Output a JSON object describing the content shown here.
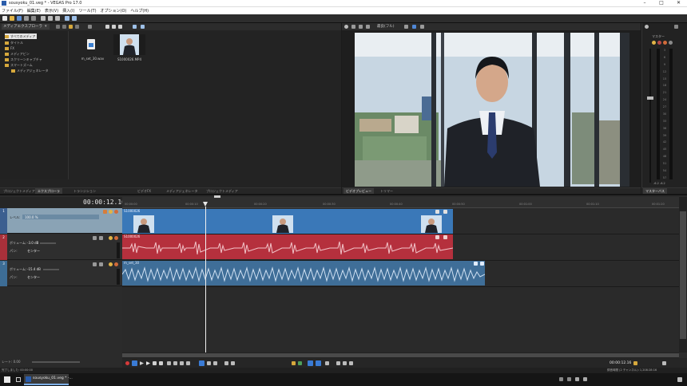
{
  "app": {
    "title": "sousyoku_01.veg * - VEGAS Pro 17.0",
    "menu": [
      "ファイル(F)",
      "編集(E)",
      "表示(V)",
      "挿入(I)",
      "ツール(T)",
      "オプション(O)",
      "ヘルプ(H)"
    ]
  },
  "explorer": {
    "dropdown": "メディアエクスプローラ",
    "tree": [
      "すべてのメディア",
      "タイトル",
      "FX",
      "メディアビン",
      "スクリーンキャプチャ",
      "スマートズーム",
      "メディアジェネレータ"
    ],
    "files": [
      {
        "name": "m_set_30.wav",
        "kind": "audio"
      },
      {
        "name": "S1000026.MP4",
        "kind": "video"
      }
    ]
  },
  "left_tabs": [
    "プロジェクトメディア",
    "エクスプローラ",
    "トランジション",
    "ビデオFX",
    "メディアジェネレータ",
    "プロジェクトメディア"
  ],
  "preview": {
    "toolbar_label": "最良(フル)",
    "tabs": [
      "ビデオプレビュー",
      "トリマー"
    ]
  },
  "mixer": {
    "label": "マスター",
    "meter_scale": [
      "3",
      "6",
      "9",
      "12",
      "15",
      "18",
      "21",
      "24",
      "27",
      "30",
      "33",
      "36",
      "39",
      "42",
      "45",
      "48",
      "51",
      "54",
      "57"
    ],
    "readout": "-6.2  -6.2",
    "tab": "マスターバス"
  },
  "timeline": {
    "timecode": "00:00:12.16",
    "ruler": [
      "00:00:00",
      "00:00:10",
      "00:00:20",
      "00:00:30",
      "00:00:40",
      "00:00:50",
      "00:01:00",
      "00:01:10",
      "00:01:20"
    ],
    "tracks": [
      {
        "type": "video",
        "num": "1",
        "level_label": "レベル:",
        "level_value": "100.0 %"
      },
      {
        "type": "audio",
        "num": "2",
        "vol_label": "ボリューム:",
        "vol_value": "-3.0 dB",
        "pan_label": "パン:",
        "pan_value": "センター"
      },
      {
        "type": "audio",
        "num": "3",
        "vol_label": "ボリューム:",
        "vol_value": "-15.4 dB",
        "pan_label": "パン:",
        "pan_value": "センター"
      }
    ],
    "clips": {
      "video": "S1000026",
      "audio1": "S1000026",
      "audio2": "m_set_30"
    },
    "rate_label": "レート: 0.00",
    "transport_time": "00:00:12.16",
    "end_label": "00:00:12.16"
  },
  "status": {
    "record_time": "録音時間 (2 チャンネル): 1,208:28:16",
    "left": "完了しました: 00:00:00"
  },
  "taskbar": {
    "app_title": "sousyoku_01.veg * -..."
  },
  "colors": {
    "video_clip": "#3a78b8",
    "audio_clip_red": "#b5303d",
    "audio_clip_blue": "#3f6e98",
    "accent": "#3a7bd5"
  }
}
